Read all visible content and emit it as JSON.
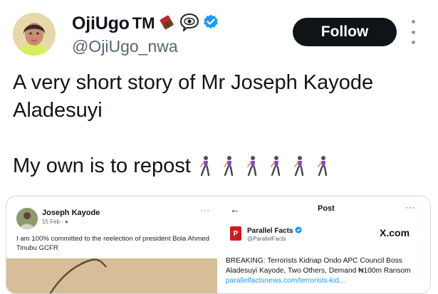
{
  "header": {
    "display_name": "OjiUgo",
    "tm": "TM",
    "handle": "@OjiUgo_nwa",
    "follow_label": "Follow"
  },
  "tweet": {
    "line1": "A very short story of Mr Joseph Kayode Aladesuyi",
    "line2": "My own is to repost"
  },
  "left_card": {
    "author": "Joseph Kayode",
    "date": "15 Feb ·",
    "more": "···",
    "text": "I am 100% committed to the reelection of president Bola Ahmed Tinubu GCFR"
  },
  "right_card": {
    "back": "←",
    "title": "Post",
    "more": "···",
    "logo_letter": "P",
    "account_name": "Parallel Facts",
    "account_handle": "@ParallelFacts",
    "source": "X.com",
    "headline": "BREAKING: Terrorists Kidnap Ondo APC Council Boss Aladesuyi Kayode, Two Others, Demand ₦100m Ransom",
    "link": "parallelfactsnews.com/terrorists-kid..."
  },
  "colors": {
    "verified": "#1d9bf0",
    "follow_bg": "#0f1419",
    "brand_red": "#c81e1e"
  }
}
